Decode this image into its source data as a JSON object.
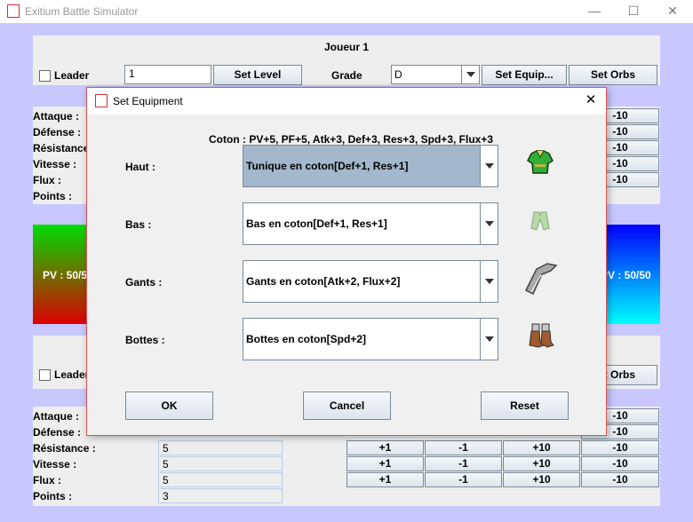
{
  "window": {
    "title": "Exitium Battle Simulator",
    "minimize": "—",
    "maximize": "☐",
    "close": "✕"
  },
  "player1": {
    "heading": "Joueur 1",
    "leader_label": "Leader",
    "level_value": "1",
    "set_level": "Set Level",
    "grade_label": "Grade",
    "grade_value": "D",
    "set_equip": "Set Equip...",
    "set_orbs": "Set Orbs",
    "stats": [
      "Attaque :",
      "Défense :",
      "Résistance :",
      "Vitesse :",
      "Flux :",
      "Points :"
    ],
    "minus10": "-10",
    "pv_left": "PV : 50/5",
    "pv_right": "PV : 50/50"
  },
  "player2": {
    "leader_label": "Leader",
    "set_orbs": "Set Orbs",
    "stats": [
      "Attaque :",
      "Défense :",
      "Résistance :",
      "Vitesse :",
      "Flux :",
      "Points :"
    ],
    "values": [
      "5",
      "5",
      "5",
      "3"
    ],
    "btn_plus1": "+1",
    "btn_minus1": "-1",
    "btn_plus10": "+10",
    "btn_minus10": "-10"
  },
  "dialog": {
    "title": "Set Equipment",
    "set_bonus": "Coton : PV+5, PF+5, Atk+3, Def+3, Res+3, Spd+3, Flux+3",
    "rows": [
      {
        "label": "Haut :",
        "value": "Tunique en coton[Def+1, Res+1]",
        "icon": "tunic-icon"
      },
      {
        "label": "Bas :",
        "value": "Bas en coton[Def+1, Res+1]",
        "icon": "pants-icon"
      },
      {
        "label": "Gants :",
        "value": "Gants en coton[Atk+2, Flux+2]",
        "icon": "gloves-icon"
      },
      {
        "label": "Bottes :",
        "value": "Bottes en coton[Spd+2]",
        "icon": "boots-icon"
      }
    ],
    "ok": "OK",
    "cancel": "Cancel",
    "reset": "Reset",
    "close": "✕"
  },
  "colors": {
    "background": "#c8c8ff",
    "panel": "#eeeeee",
    "combo_selected": "#a3b8cc",
    "dialog_border": "#e05555"
  }
}
